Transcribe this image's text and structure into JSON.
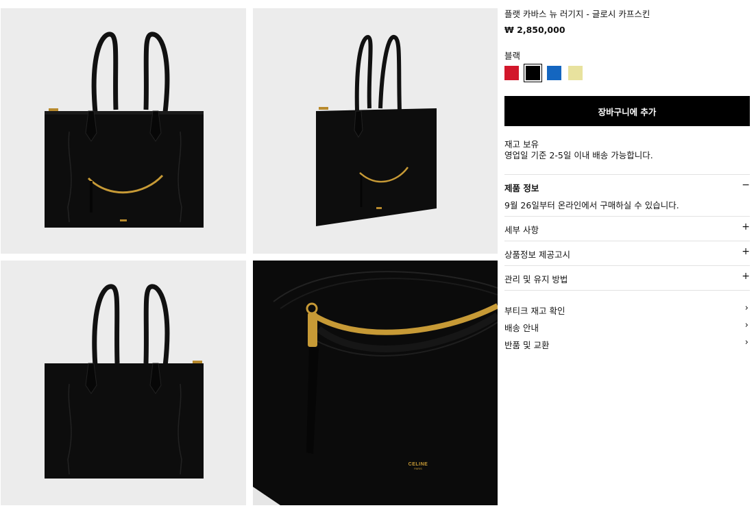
{
  "gallery": {
    "images": [
      {
        "alt": "front view"
      },
      {
        "alt": "side view"
      },
      {
        "alt": "back view"
      },
      {
        "alt": "detail view"
      }
    ],
    "logo_text": "CELINE",
    "logo_sub": "PARIS"
  },
  "product": {
    "title": "플랫 카바스 뉴 러기지 - 글로시 카프스킨",
    "price": "₩ 2,850,000",
    "color_name": "블랙",
    "swatches": [
      {
        "name": "red",
        "color": "#d2172b"
      },
      {
        "name": "black",
        "color": "#000000",
        "selected": true
      },
      {
        "name": "blue",
        "color": "#1466c0"
      },
      {
        "name": "yellow",
        "color": "#e8e29e"
      }
    ],
    "add_to_cart": "장바구니에 추가",
    "stock_line1": "재고 보유",
    "stock_line2": "영업일 기준 2-5일 이내 배송 가능합니다."
  },
  "accordion": {
    "product_info": {
      "label": "제품 정보",
      "sign": "−",
      "body": "9월 26일부터 온라인에서 구매하실 수 있습니다."
    },
    "details": {
      "label": "세부 사항",
      "sign": "+"
    },
    "notice": {
      "label": "상품정보 제공고시",
      "sign": "+"
    },
    "care": {
      "label": "관리 및 유지 방법",
      "sign": "+"
    }
  },
  "links": {
    "boutique": {
      "label": "부티크 재고 확인",
      "chev": "›"
    },
    "delivery": {
      "label": "배송 안내",
      "chev": "›"
    },
    "returns": {
      "label": "반품 및 교환",
      "chev": "›"
    }
  }
}
